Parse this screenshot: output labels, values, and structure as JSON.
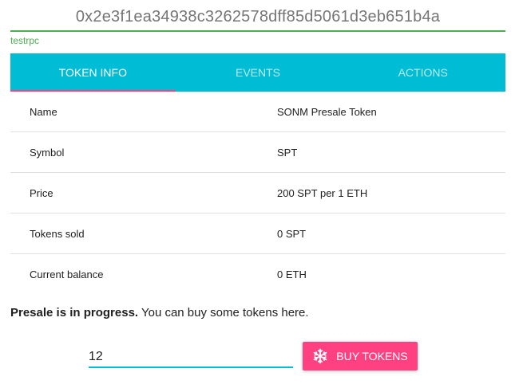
{
  "header": {
    "address": "0x2e3f1ea34938c3262578dff85d5061d3eb651b4a",
    "network": "testrpc"
  },
  "tabs": [
    {
      "label": "TOKEN INFO",
      "active": true
    },
    {
      "label": "EVENTS",
      "active": false
    },
    {
      "label": "ACTIONS",
      "active": false
    }
  ],
  "token_info": [
    {
      "key": "Name",
      "value": "SONM Presale Token"
    },
    {
      "key": "Symbol",
      "value": "SPT"
    },
    {
      "key": "Price",
      "value": "200 SPT per 1 ETH"
    },
    {
      "key": "Tokens sold",
      "value": "0 SPT"
    },
    {
      "key": "Current balance",
      "value": "0 ETH"
    }
  ],
  "presale": {
    "status_bold": "Presale is in progress.",
    "status_text": " You can buy some tokens here."
  },
  "buy": {
    "input_value": "12",
    "button_label": "BUY TOKENS",
    "button_icon": "snowflake-icon"
  },
  "colors": {
    "accent": "#00bcd4",
    "pink": "#ff4081",
    "green": "#4caf50"
  }
}
